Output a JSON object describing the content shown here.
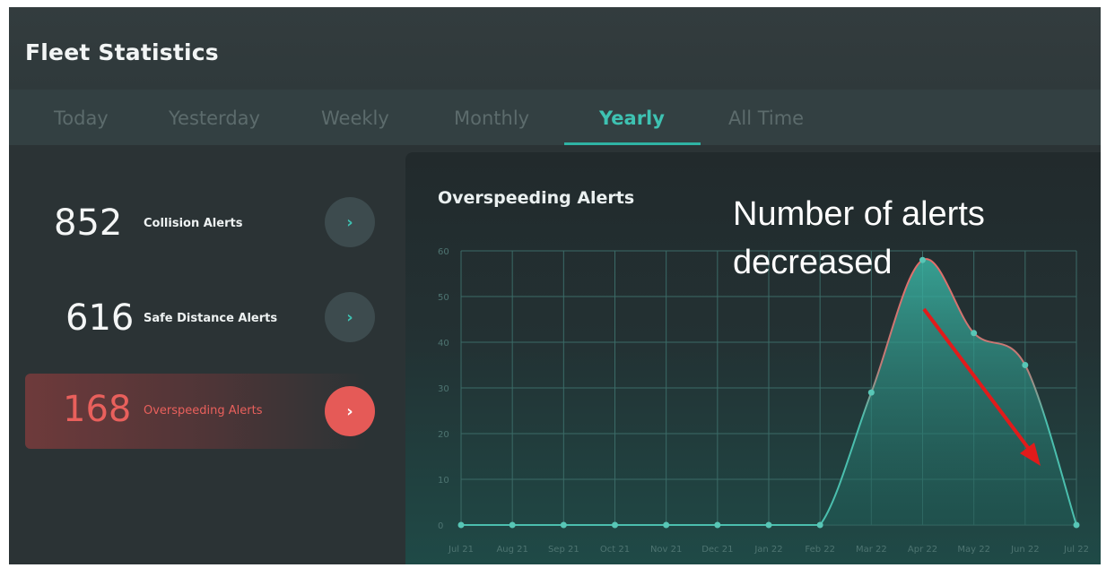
{
  "header": {
    "title": "Fleet Statistics"
  },
  "tabs": [
    {
      "label": "Today"
    },
    {
      "label": "Yesterday"
    },
    {
      "label": "Weekly"
    },
    {
      "label": "Monthly"
    },
    {
      "label": "Yearly"
    },
    {
      "label": "All Time"
    }
  ],
  "active_tab": "Yearly",
  "stats": [
    {
      "value": "852",
      "label": "Collision Alerts",
      "arrow": "›"
    },
    {
      "value": "616",
      "label": "Safe Distance Alerts",
      "arrow": "›"
    },
    {
      "value": "168",
      "label": "Overspeeding Alerts",
      "arrow": "›"
    }
  ],
  "annotation": {
    "text_line1": "Number of alerts",
    "text_line2": "decreased"
  },
  "colors": {
    "accent": "#3ec2b2",
    "alert": "#e55a57",
    "background": "#2b3335"
  },
  "icons": {
    "stat_arrow": "chevron-right-icon",
    "annotation_arrow": "red-arrow-icon"
  },
  "chart_data": {
    "type": "area",
    "title": "Overspeeding Alerts",
    "categories": [
      "Jul 21",
      "Aug 21",
      "Sep 21",
      "Oct 21",
      "Nov 21",
      "Dec 21",
      "Jan 22",
      "Feb 22",
      "Mar 22",
      "Apr 22",
      "May 22",
      "Jun 22",
      "Jul 22"
    ],
    "values": [
      0,
      0,
      0,
      0,
      0,
      0,
      0,
      0,
      29,
      58,
      42,
      35,
      0
    ],
    "yticks": [
      "0",
      "10",
      "20",
      "30",
      "40",
      "50",
      "60"
    ],
    "ylim": [
      0,
      60
    ],
    "grid": true
  }
}
